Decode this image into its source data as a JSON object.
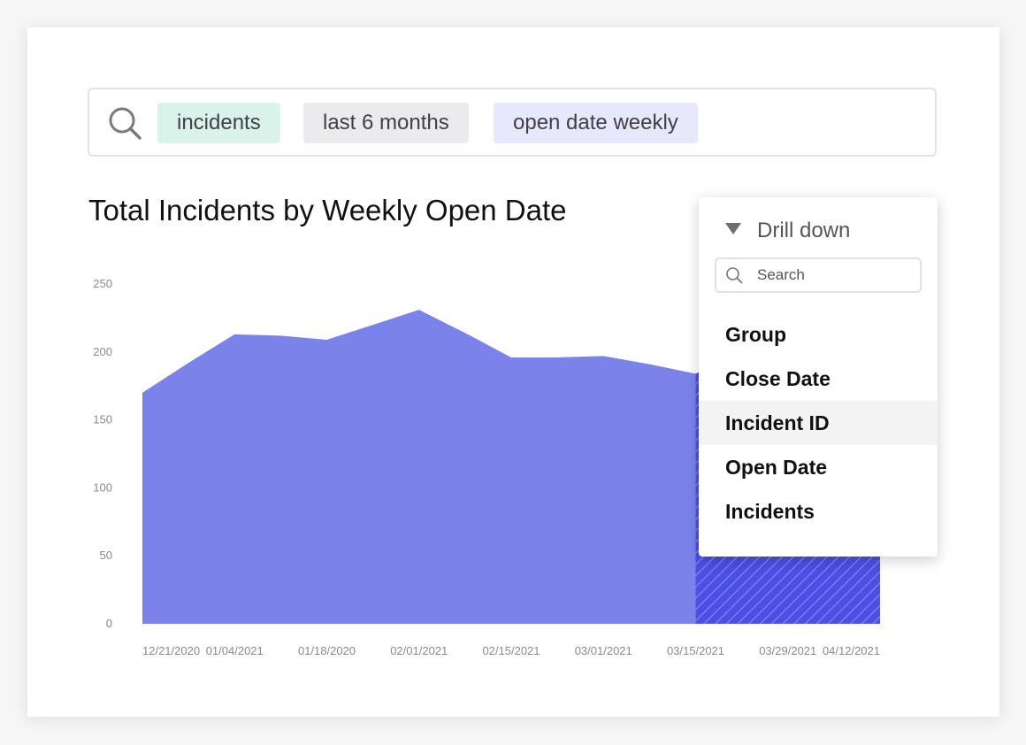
{
  "search": {
    "chips": [
      {
        "label": "incidents",
        "color": "#d9f2ea"
      },
      {
        "label": "last 6 months",
        "color": "#ebebed"
      },
      {
        "label": "open date weekly",
        "color": "#e7e8fb"
      }
    ]
  },
  "chart_data": {
    "type": "area",
    "title": "Total Incidents by Weekly Open Date",
    "xlabel": "",
    "ylabel": "",
    "ylim": [
      0,
      250
    ],
    "yticks": [
      0,
      50,
      100,
      150,
      200,
      250
    ],
    "categories": [
      "12/21/2020",
      "01/04/2021",
      "01/18/2020",
      "02/01/2021",
      "02/15/2021",
      "03/01/2021",
      "03/15/2021",
      "03/29/2021",
      "04/12/2021"
    ],
    "x": [
      "12/21/2020",
      "12/28/2020",
      "01/04/2021",
      "01/11/2021",
      "01/18/2021",
      "01/25/2021",
      "02/01/2021",
      "02/08/2021",
      "02/15/2021",
      "02/22/2021",
      "03/01/2021",
      "03/08/2021",
      "03/15/2021",
      "03/22/2021",
      "03/29/2021",
      "04/05/2021",
      "04/12/2021"
    ],
    "series": [
      {
        "values": [
          170,
          192,
          213,
          212,
          209,
          220,
          231,
          214,
          196,
          196,
          197,
          191,
          184,
          199,
          213,
          220,
          225
        ]
      }
    ],
    "forecast_start_index": 12,
    "grid": false,
    "legend": "none",
    "colors": {
      "actual": "#7b83eb",
      "forecast": "#4c4fe4"
    }
  },
  "drill_down": {
    "header": "Drill down",
    "search_placeholder": "Search",
    "items": [
      {
        "label": "Group",
        "highlighted": false
      },
      {
        "label": "Close Date",
        "highlighted": false
      },
      {
        "label": "Incident ID",
        "highlighted": true
      },
      {
        "label": "Open Date",
        "highlighted": false
      },
      {
        "label": "Incidents",
        "highlighted": false
      }
    ]
  }
}
